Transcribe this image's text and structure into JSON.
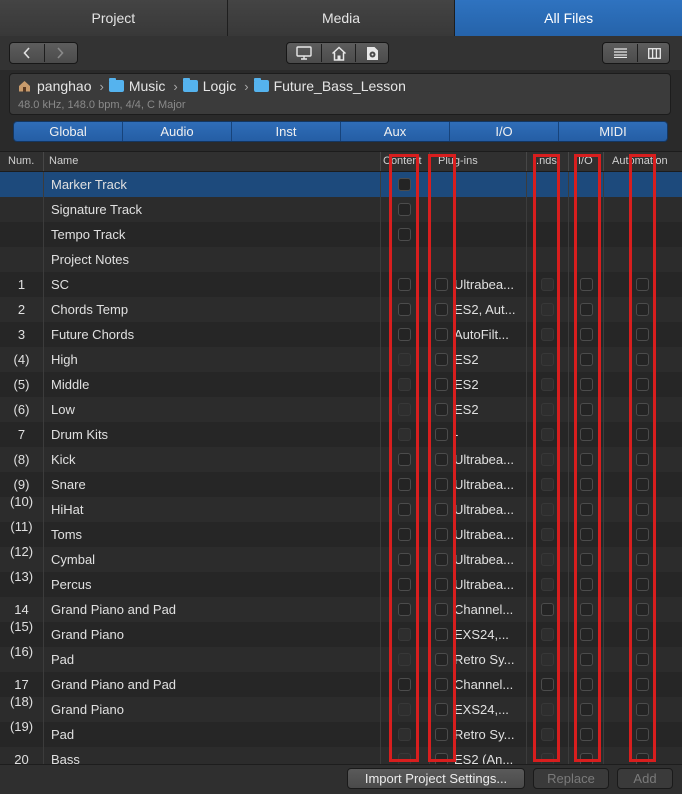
{
  "tabs": [
    "Project",
    "Media",
    "All Files"
  ],
  "active_tab": "All Files",
  "path": {
    "user": "panghao",
    "folder1": "Music",
    "folder2": "Logic",
    "folder3": "Future_Bass_Lesson"
  },
  "project_info": "48.0 kHz, 148.0 bpm, 4/4, C Major",
  "filters": [
    "Global",
    "Audio",
    "Inst",
    "Aux",
    "I/O",
    "MIDI"
  ],
  "columns": {
    "num": "Num.",
    "name": "Name",
    "content": "Content",
    "plugins": "Plug-ins",
    "sends": "..nds",
    "io": "I/O",
    "automation": "Automation"
  },
  "rows": [
    {
      "num": "",
      "name": "Marker Track",
      "plugins": "",
      "selected": true,
      "checks": [
        1,
        0,
        0,
        0,
        0
      ]
    },
    {
      "num": "",
      "name": "Signature Track",
      "plugins": "",
      "checks": [
        1,
        0,
        0,
        0,
        0
      ]
    },
    {
      "num": "",
      "name": "Tempo Track",
      "plugins": "",
      "checks": [
        1,
        0,
        0,
        0,
        0
      ]
    },
    {
      "num": "",
      "name": "Project Notes",
      "plugins": "",
      "checks": [
        0,
        0,
        0,
        0,
        0
      ]
    },
    {
      "num": "1",
      "name": "SC",
      "plugins": "Ultrabea...",
      "checks": [
        1,
        1,
        2,
        1,
        1
      ]
    },
    {
      "num": "2",
      "name": "Chords Temp",
      "plugins": "ES2, Aut...",
      "checks": [
        1,
        1,
        2,
        1,
        1
      ]
    },
    {
      "num": "3",
      "name": "Future Chords",
      "plugins": "AutoFilt...",
      "checks": [
        1,
        1,
        2,
        1,
        1
      ]
    },
    {
      "num": "(4)",
      "name": "High",
      "plugins": "ES2",
      "checks": [
        2,
        1,
        2,
        1,
        1
      ]
    },
    {
      "num": "(5)",
      "name": "Middle",
      "plugins": "ES2",
      "checks": [
        2,
        1,
        2,
        1,
        1
      ]
    },
    {
      "num": "(6)",
      "name": "Low",
      "plugins": "ES2",
      "checks": [
        2,
        1,
        2,
        1,
        1
      ]
    },
    {
      "num": "7",
      "name": "Drum Kits",
      "plugins": "-",
      "checks": [
        2,
        1,
        2,
        1,
        1
      ]
    },
    {
      "num": "(8)",
      "name": "Kick",
      "plugins": "Ultrabea...",
      "checks": [
        1,
        1,
        2,
        1,
        1
      ]
    },
    {
      "num": "(9)",
      "name": "Snare",
      "plugins": "Ultrabea...",
      "checks": [
        1,
        1,
        2,
        1,
        1
      ]
    },
    {
      "num": "(10)",
      "name": "HiHat",
      "plugins": "Ultrabea...",
      "checks": [
        1,
        1,
        2,
        1,
        1
      ]
    },
    {
      "num": "(11)",
      "name": "Toms",
      "plugins": "Ultrabea...",
      "checks": [
        1,
        1,
        2,
        1,
        1
      ]
    },
    {
      "num": "(12)",
      "name": "Cymbal",
      "plugins": "Ultrabea...",
      "checks": [
        1,
        1,
        2,
        1,
        1
      ]
    },
    {
      "num": "(13)",
      "name": "Percus",
      "plugins": "Ultrabea...",
      "checks": [
        1,
        1,
        2,
        1,
        1
      ]
    },
    {
      "num": "14",
      "name": "Grand Piano and Pad",
      "plugins": "Channel...",
      "checks": [
        1,
        1,
        1,
        1,
        1
      ]
    },
    {
      "num": "(15)",
      "name": "Grand Piano",
      "plugins": "EXS24,...",
      "checks": [
        2,
        1,
        2,
        1,
        1
      ]
    },
    {
      "num": "(16)",
      "name": "Pad",
      "plugins": "Retro Sy...",
      "checks": [
        2,
        1,
        2,
        1,
        1
      ]
    },
    {
      "num": "17",
      "name": "Grand Piano and Pad",
      "plugins": "Channel...",
      "checks": [
        1,
        1,
        1,
        1,
        1
      ]
    },
    {
      "num": "(18)",
      "name": "Grand Piano",
      "plugins": "EXS24,...",
      "checks": [
        2,
        1,
        2,
        1,
        1
      ]
    },
    {
      "num": "(19)",
      "name": "Pad",
      "plugins": "Retro Sy...",
      "checks": [
        2,
        1,
        2,
        1,
        1
      ]
    },
    {
      "num": "20",
      "name": "Bass",
      "plugins": "ES2 (An...",
      "checks": [
        2,
        1,
        2,
        1,
        1
      ]
    }
  ],
  "footer": {
    "import": "Import Project Settings...",
    "replace": "Replace",
    "add": "Add"
  },
  "colors": {
    "accent": "#2a69b2",
    "highlight": "#d81e1e",
    "selected_row": "#1d4a7c"
  }
}
